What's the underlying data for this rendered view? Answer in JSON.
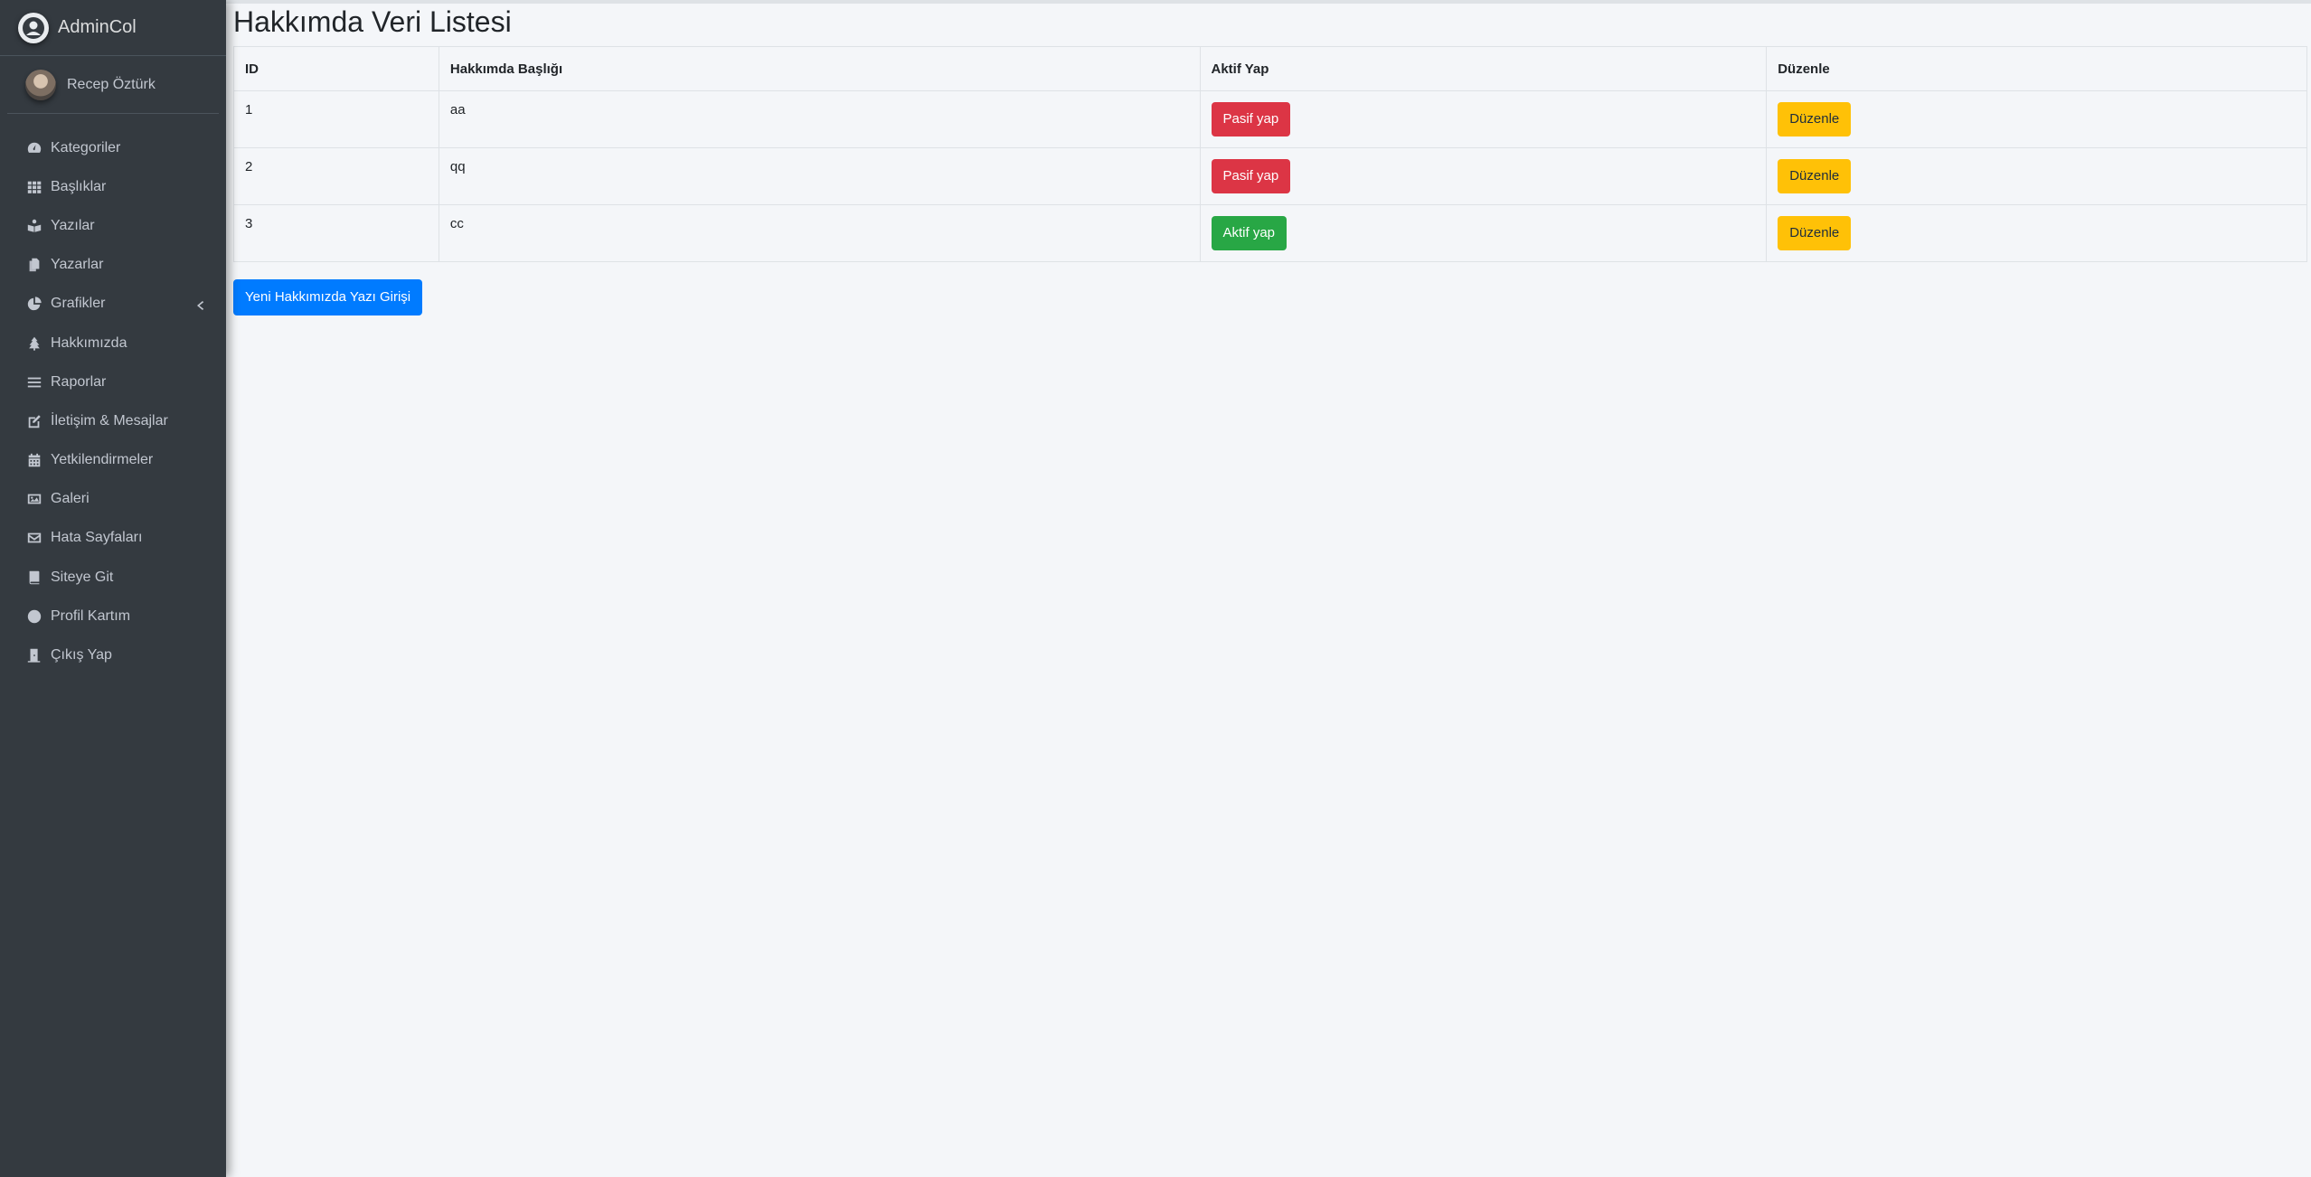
{
  "brand": {
    "name": "AdminCol"
  },
  "user": {
    "name": "Recep Öztürk"
  },
  "sidebar": {
    "items": [
      {
        "label": "Kategoriler",
        "icon": "gauge-icon"
      },
      {
        "label": "Başlıklar",
        "icon": "grid-icon"
      },
      {
        "label": "Yazılar",
        "icon": "reader-icon"
      },
      {
        "label": "Yazarlar",
        "icon": "copy-icon"
      },
      {
        "label": "Grafikler",
        "icon": "pie-chart-icon"
      },
      {
        "label": "Hakkımızda",
        "icon": "tree-icon"
      },
      {
        "label": "Raporlar",
        "icon": "list-icon"
      },
      {
        "label": "İletişim & Mesajlar",
        "icon": "edit-icon"
      },
      {
        "label": "Yetkilendirmeler",
        "icon": "calendar-icon"
      },
      {
        "label": "Galeri",
        "icon": "image-icon"
      },
      {
        "label": "Hata Sayfaları",
        "icon": "envelope-icon"
      },
      {
        "label": "Siteye Git",
        "icon": "book-icon"
      },
      {
        "label": "Profil Kartım",
        "icon": "circle-icon"
      },
      {
        "label": "Çıkış Yap",
        "icon": "door-icon"
      }
    ]
  },
  "page": {
    "title": "Hakkımda Veri Listesi"
  },
  "table": {
    "headers": [
      "ID",
      "Hakkımda Başlığı",
      "Aktif Yap",
      "Düzenle"
    ],
    "rows": [
      {
        "id": "1",
        "title": "aa",
        "status_button": "Pasif yap",
        "status_color": "#dc3545",
        "edit_button": "Düzenle"
      },
      {
        "id": "2",
        "title": "qq",
        "status_button": "Pasif yap",
        "status_color": "#dc3545",
        "edit_button": "Düzenle"
      },
      {
        "id": "3",
        "title": "cc",
        "status_button": "Aktif yap",
        "status_color": "#28a745",
        "edit_button": "Düzenle"
      }
    ]
  },
  "actions": {
    "new_entry": "Yeni Hakkımızda Yazı Girişi"
  },
  "colors": {
    "sidebar_bg": "#343a40",
    "danger": "#dc3545",
    "success": "#28a745",
    "warning": "#ffc107",
    "primary": "#007bff"
  }
}
